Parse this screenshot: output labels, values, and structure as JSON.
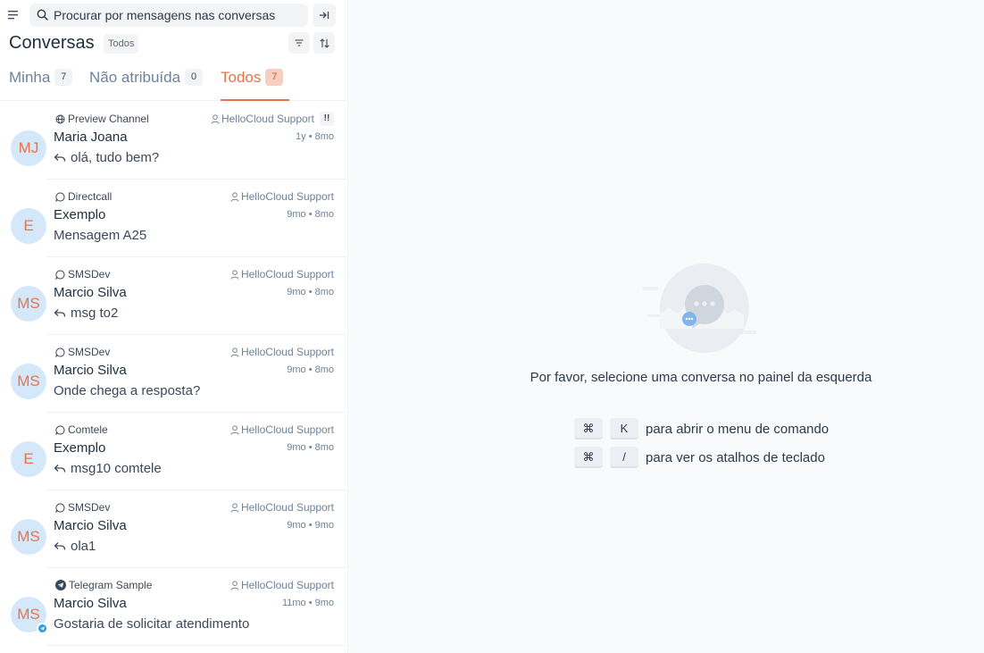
{
  "search": {
    "placeholder": "Procurar por mensagens nas conversas"
  },
  "header": {
    "title": "Conversas",
    "status_filter": "Todos"
  },
  "tabs": [
    {
      "label": "Minha",
      "count": "7"
    },
    {
      "label": "Não atribuída",
      "count": "0"
    },
    {
      "label": "Todos",
      "count": "7"
    }
  ],
  "conversations": [
    {
      "inbox": "Preview Channel",
      "inbox_icon": "globe-icon",
      "agent": "HelloCloud Support",
      "priority": "!!",
      "avatar": "MJ",
      "name": "Maria Joana",
      "time": "1y • 8mo",
      "replied": true,
      "message": "olá, tudo bem?"
    },
    {
      "inbox": "Directcall",
      "inbox_icon": "chat-bubble-icon",
      "agent": "HelloCloud Support",
      "avatar": "E",
      "name": "Exemplo",
      "time": "9mo • 8mo",
      "replied": false,
      "message": "Mensagem A25"
    },
    {
      "inbox": "SMSDev",
      "inbox_icon": "chat-bubble-icon",
      "agent": "HelloCloud Support",
      "avatar": "MS",
      "name": "Marcio Silva",
      "time": "9mo • 8mo",
      "replied": true,
      "message": "msg to2"
    },
    {
      "inbox": "SMSDev",
      "inbox_icon": "chat-bubble-icon",
      "agent": "HelloCloud Support",
      "avatar": "MS",
      "name": "Marcio Silva",
      "time": "9mo • 8mo",
      "replied": false,
      "message": "Onde chega a resposta?"
    },
    {
      "inbox": "Comtele",
      "inbox_icon": "chat-bubble-icon",
      "agent": "HelloCloud Support",
      "avatar": "E",
      "name": "Exemplo",
      "time": "9mo • 8mo",
      "replied": true,
      "message": "msg10 comtele"
    },
    {
      "inbox": "SMSDev",
      "inbox_icon": "chat-bubble-icon",
      "agent": "HelloCloud Support",
      "avatar": "MS",
      "name": "Marcio Silva",
      "time": "9mo • 9mo",
      "replied": true,
      "message": "ola1"
    },
    {
      "inbox": "Telegram Sample",
      "inbox_icon": "telegram-icon",
      "agent": "HelloCloud Support",
      "avatar": "MS",
      "name": "Marcio Silva",
      "time": "11mo • 9mo",
      "replied": false,
      "message": "Gostaria de solicitar atendimento"
    }
  ],
  "empty_state": {
    "message": "Por favor, selecione uma conversa no painel da esquerda",
    "shortcuts": [
      {
        "keys": [
          "⌘",
          "K"
        ],
        "description": "para abrir o menu de comando"
      },
      {
        "keys": [
          "⌘",
          "/"
        ],
        "description": "para ver os atalhos de teclado"
      }
    ]
  },
  "colors": {
    "accent": "#e8744a",
    "avatar_bg": "#d4e8fa",
    "muted": "#6e8299"
  }
}
